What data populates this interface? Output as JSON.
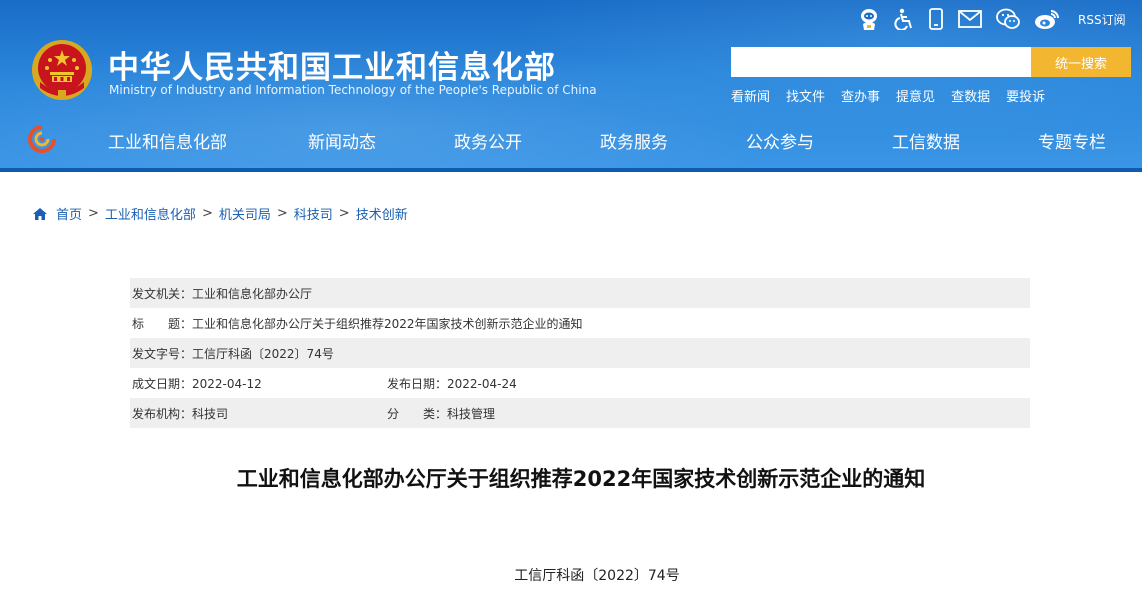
{
  "header": {
    "title": "中华人民共和国工业和信息化部",
    "subtitle": "Ministry of Industry and Information Technology of the People's Republic of China",
    "top_icons": [
      "guide-robot-icon",
      "accessibility-icon",
      "mobile-icon",
      "mail-icon",
      "wechat-icon",
      "weibo-icon",
      "rss-icon"
    ],
    "rss_label": "RSS订阅",
    "search": {
      "placeholder": "",
      "button_label": "统一搜索"
    },
    "quick_links": [
      "看新闻",
      "找文件",
      "查办事",
      "提意见",
      "查数据",
      "要投诉"
    ],
    "colors": {
      "header_blue": "#2a86db",
      "search_button": "#f2b631"
    }
  },
  "nav": {
    "items": [
      "工业和信息化部",
      "新闻动态",
      "政务公开",
      "政务服务",
      "公众参与",
      "工信数据",
      "专题专栏"
    ]
  },
  "breadcrumb": {
    "items": [
      "首页",
      "工业和信息化部",
      "机关司局",
      "科技司",
      "技术创新"
    ],
    "separator": ">"
  },
  "meta": {
    "issuer_label": "发文机关：",
    "issuer": "工业和信息化部办公厅",
    "title_label": "标　　题：",
    "title": "工业和信息化部办公厅关于组织推荐2022年国家技术创新示范企业的通知",
    "docno_label": "发文字号：",
    "docno": "工信厅科函〔2022〕74号",
    "written_label": "成文日期：",
    "written_date": "2022-04-12",
    "published_label": "发布日期：",
    "published_date": "2022-04-24",
    "org_label": "发布机构：",
    "org": "科技司",
    "category_label": "分　　类：",
    "category": "科技管理"
  },
  "document": {
    "title": "工业和信息化部办公厅关于组织推荐2022年国家技术创新示范企业的通知",
    "number": "工信厅科函〔2022〕74号"
  }
}
